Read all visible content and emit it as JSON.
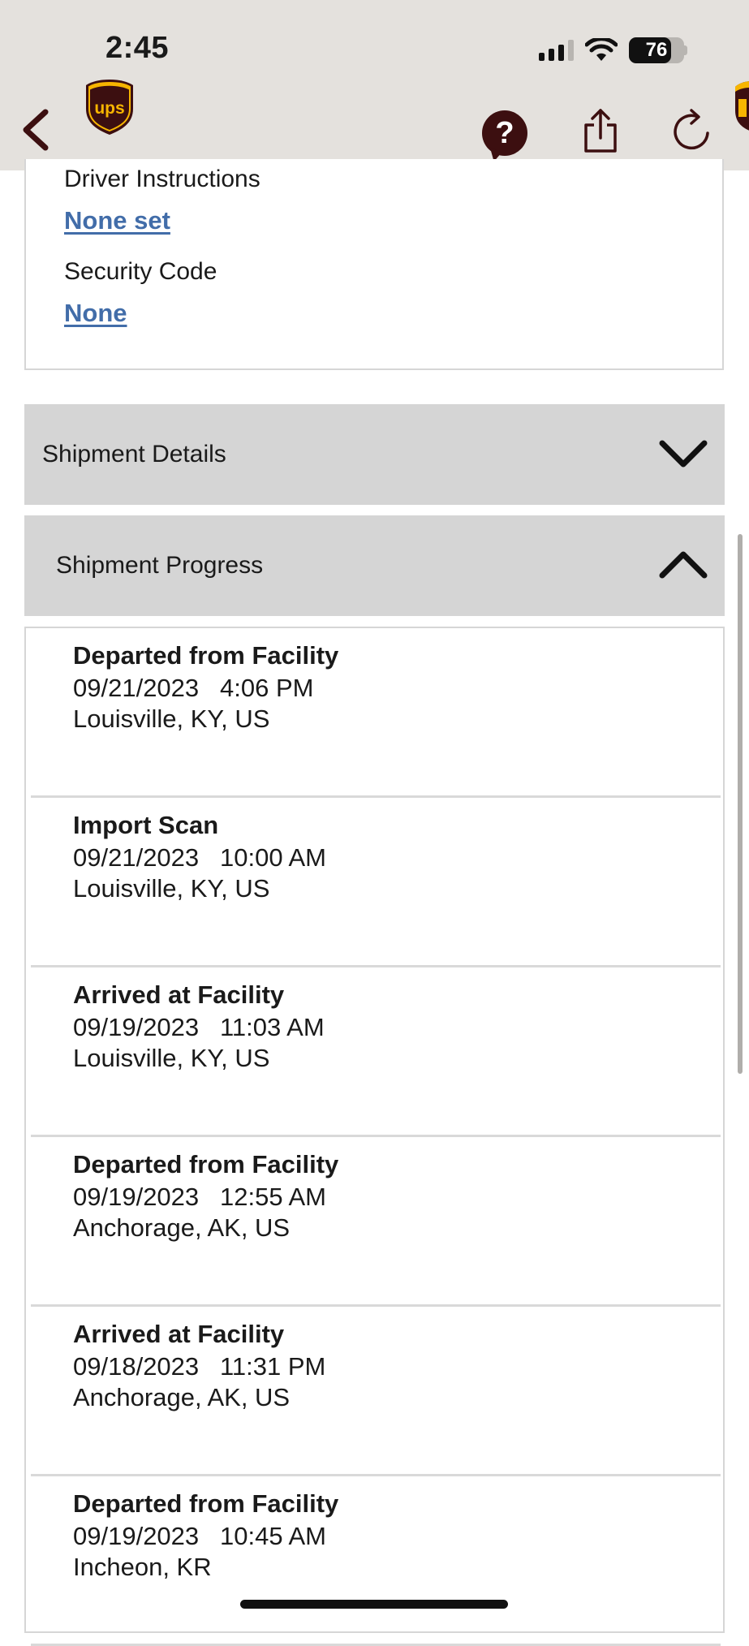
{
  "status_bar": {
    "time": "2:45",
    "battery_percent": "76",
    "battery_level": 0.76,
    "signal_bars_active": 3,
    "signal_bars_total": 4
  },
  "nav": {
    "back_icon": "chevron-left-icon",
    "logo_text": "ups",
    "help_label": "?",
    "share_icon": "share-icon",
    "refresh_icon": "refresh-icon"
  },
  "delivery_info": {
    "driver_instructions_label": "Driver Instructions",
    "driver_instructions_value": "None set",
    "security_code_label": "Security Code",
    "security_code_value": "None"
  },
  "sections": {
    "shipment_details": {
      "label": "Shipment Details",
      "expanded": false
    },
    "shipment_progress": {
      "label": "Shipment Progress",
      "expanded": true
    }
  },
  "progress_events": [
    {
      "status": "Departed from Facility",
      "datetime": "09/21/2023   4:06 PM",
      "location": "Louisville, KY, US"
    },
    {
      "status": "Import Scan",
      "datetime": "09/21/2023   10:00 AM",
      "location": "Louisville, KY, US"
    },
    {
      "status": "Arrived at Facility",
      "datetime": "09/19/2023   11:03 AM",
      "location": "Louisville, KY, US"
    },
    {
      "status": "Departed from Facility",
      "datetime": "09/19/2023   12:55 AM",
      "location": "Anchorage, AK, US"
    },
    {
      "status": "Arrived at Facility",
      "datetime": "09/18/2023   11:31 PM",
      "location": "Anchorage, AK, US"
    },
    {
      "status": "Departed from Facility",
      "datetime": "09/19/2023   10:45 AM",
      "location": "Incheon, KR"
    }
  ],
  "colors": {
    "ups_brown": "#3c0f10",
    "ups_gold": "#f7b500",
    "link_blue": "#426da9",
    "header_bg": "#e4e1dd",
    "accordion_bg": "#d5d5d5"
  }
}
